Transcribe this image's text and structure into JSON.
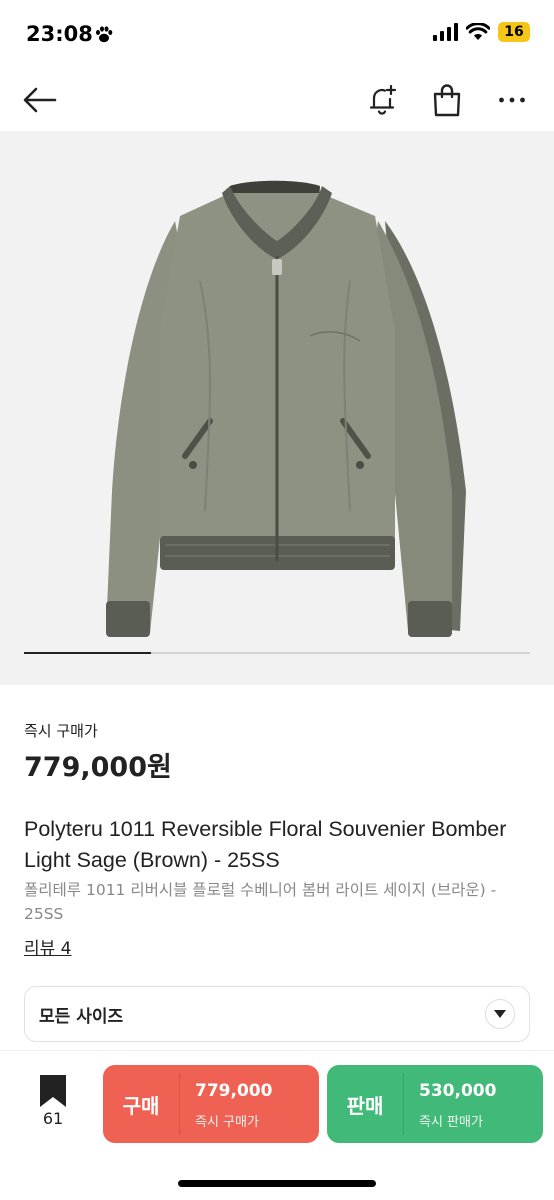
{
  "status_bar": {
    "time": "23:08",
    "battery": "16"
  },
  "nav": {
    "back_icon": "arrow-left-icon",
    "icons": [
      "bell-plus-icon",
      "shopping-bag-icon",
      "more-horizontal-icon"
    ]
  },
  "product": {
    "image": "green-bomber-jacket-photo",
    "gallery_progress": 0.25,
    "price_label": "즉시 구매가",
    "price": "779,000원",
    "title_en": "Polyteru 1011 Reversible Floral Souvenier Bomber Light Sage (Brown) - 25SS",
    "title_ko": "폴리테루 1011 리버시블 플로럴 수베니어 봄버 라이트 세이지 (브라운) - 25SS",
    "review_link": "리뷰 4"
  },
  "size_select": {
    "label": "모든 사이즈"
  },
  "bottom_bar": {
    "bookmark_count": "61",
    "buy": {
      "label": "구매",
      "price": "779,000",
      "sub": "즉시 구매가",
      "color": "#ef6253"
    },
    "sell": {
      "label": "판매",
      "price": "530,000",
      "sub": "즉시 판매가",
      "color": "#41b979"
    }
  }
}
